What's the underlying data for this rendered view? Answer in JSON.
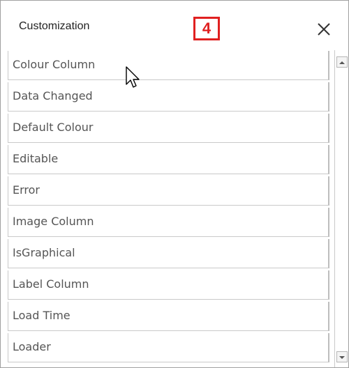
{
  "window": {
    "title": "Customization",
    "badge": "4"
  },
  "list": {
    "items": [
      "Colour Column",
      "Data Changed",
      "Default Colour",
      "Editable",
      "Error",
      "Image Column",
      "IsGraphical",
      "Label Column",
      "Load Time",
      "Loader"
    ]
  },
  "icons": {
    "close": "close-icon",
    "scroll_up": "chevron-up-icon",
    "scroll_down": "chevron-down-icon",
    "cursor": "mouse-pointer-icon"
  },
  "colors": {
    "badge": "#e02020",
    "text": "#555555",
    "border": "#c9c9c9"
  }
}
